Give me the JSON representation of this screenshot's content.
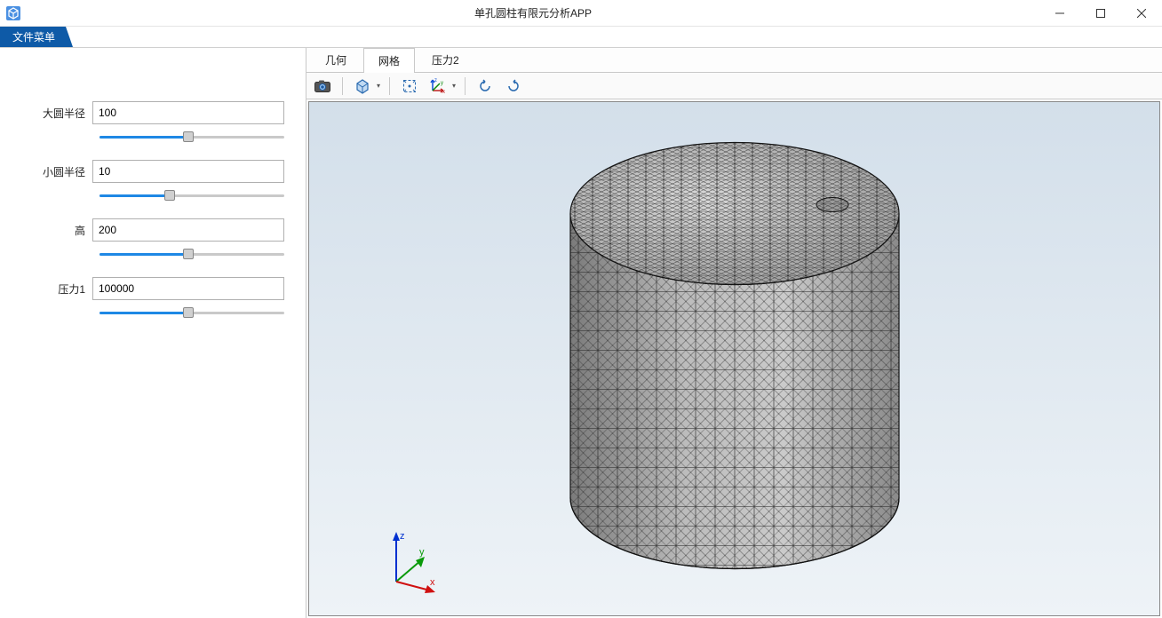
{
  "window": {
    "title": "单孔圆柱有限元分析APP"
  },
  "menu": {
    "file_label": "文件菜单"
  },
  "params": [
    {
      "label": "大圆半径",
      "value": "100",
      "slider_percent": 48
    },
    {
      "label": "小圆半径",
      "value": "10",
      "slider_percent": 38
    },
    {
      "label": "高",
      "value": "200",
      "slider_percent": 48
    },
    {
      "label": "压力1",
      "value": "100000",
      "slider_percent": 48
    }
  ],
  "tabs": [
    {
      "label": "几何",
      "active": false
    },
    {
      "label": "网格",
      "active": true
    },
    {
      "label": "压力2",
      "active": false
    }
  ],
  "axes": {
    "x": "x",
    "y": "y",
    "z": "z"
  },
  "colors": {
    "primary": "#0e5aa7",
    "slider_fill": "#1e88e5",
    "viewport_top": "#d3dfea",
    "viewport_bottom": "#eef3f7"
  }
}
